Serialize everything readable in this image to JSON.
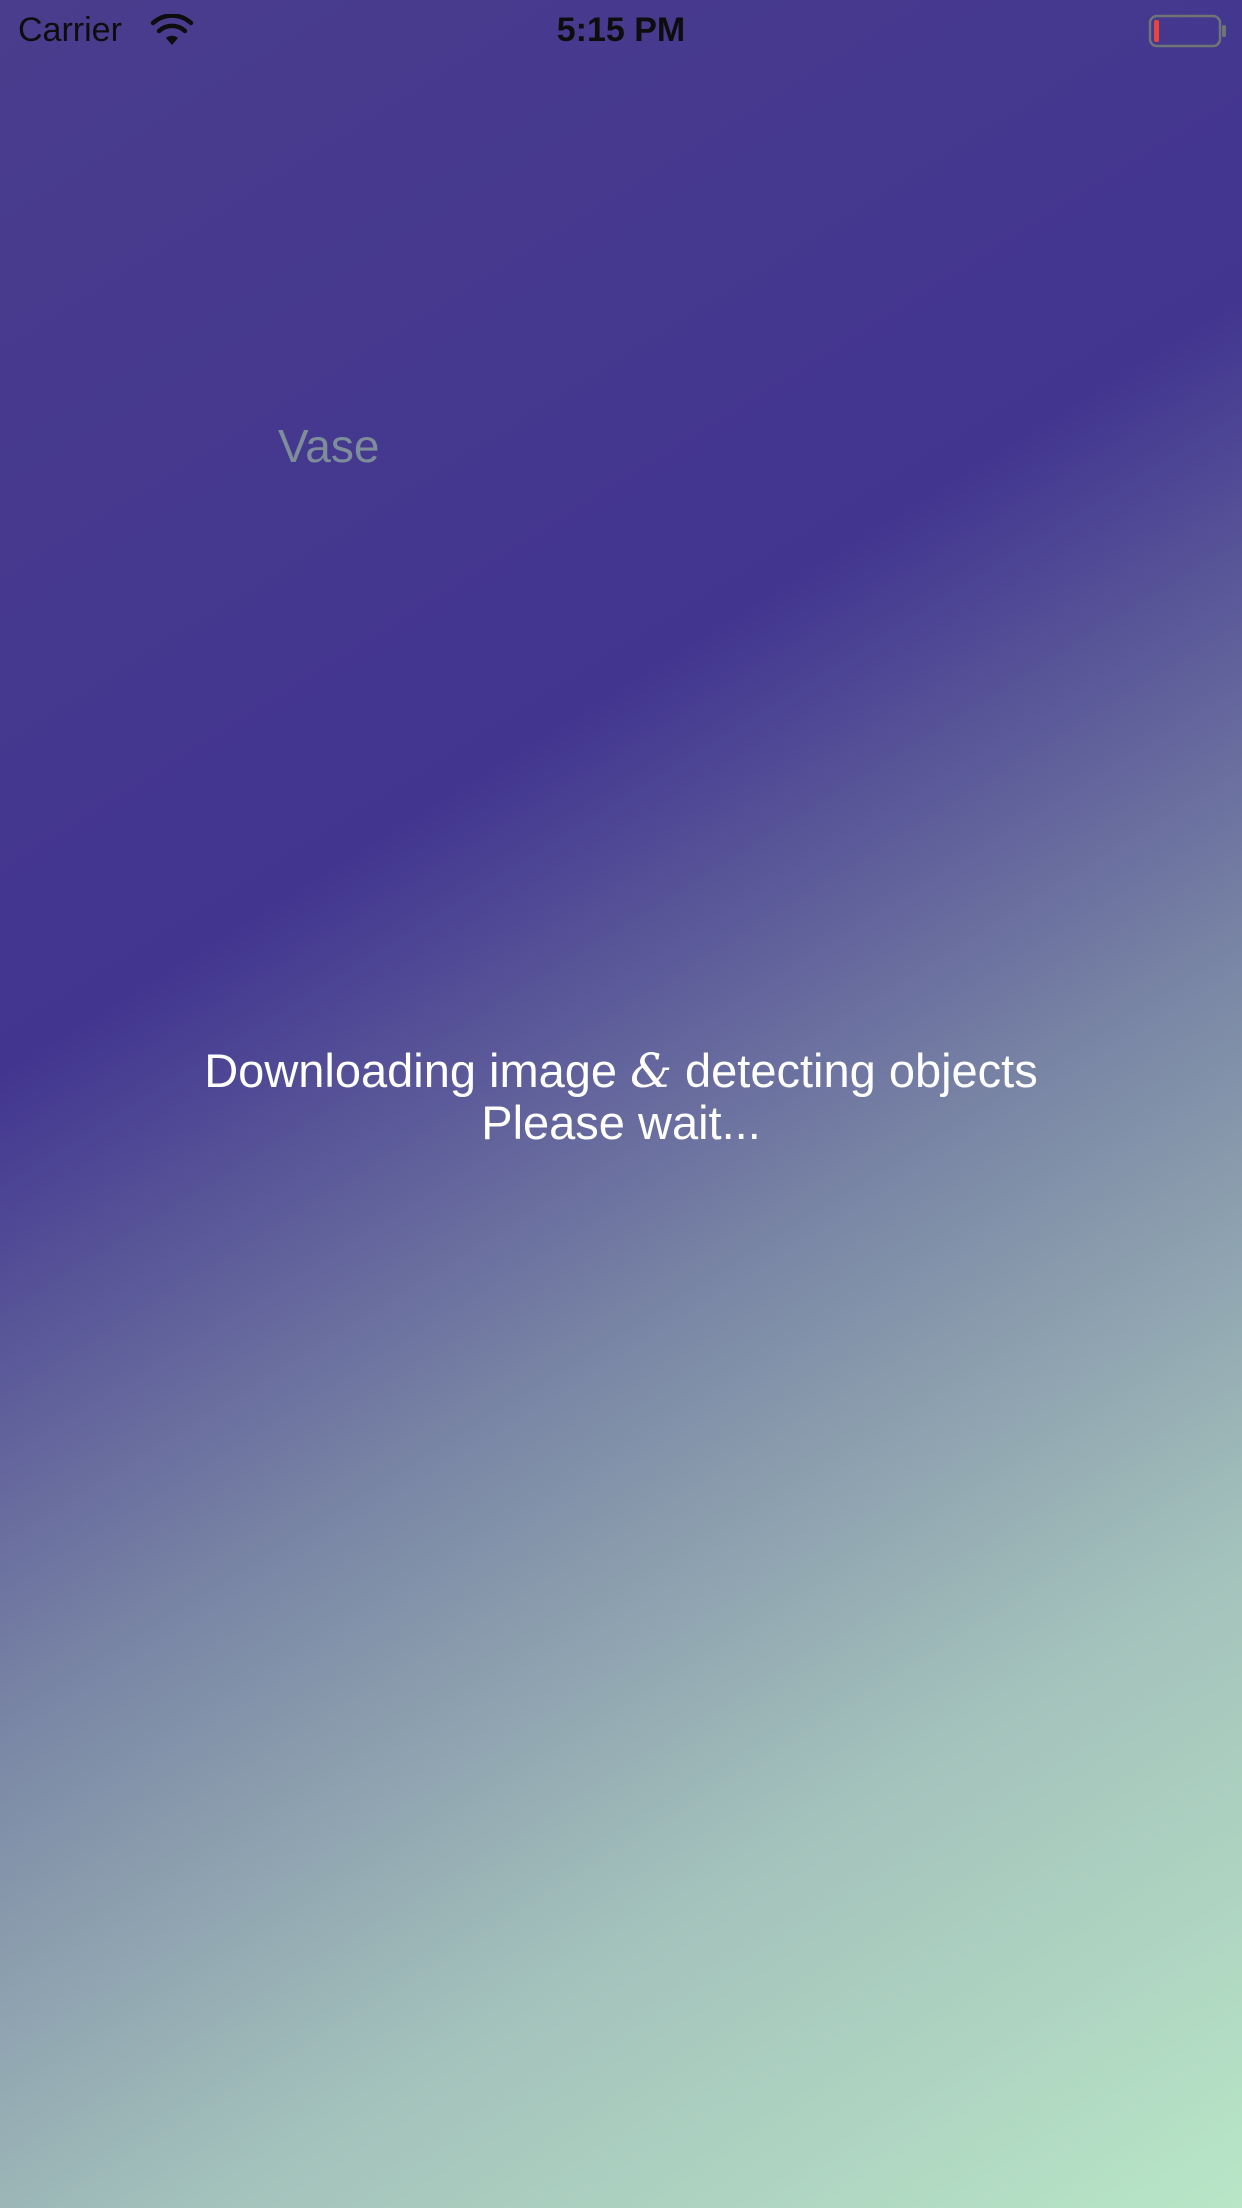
{
  "status_bar": {
    "carrier": "Carrier",
    "time": "5:15 PM",
    "wifi_icon": "wifi-icon",
    "battery_icon": "battery-low-icon",
    "battery_level_fraction": 0.08,
    "battery_level_color": "#e8453c"
  },
  "detected_label": "Vase",
  "loading": {
    "line1_before": "Downloading image ",
    "line1_amp": "&",
    "line1_after": " detecting objects",
    "line2": "Please wait..."
  },
  "colors": {
    "gradient_dark": "#423590",
    "gradient_light": "#b8e6c6",
    "label_text": "#7d8e9a"
  }
}
